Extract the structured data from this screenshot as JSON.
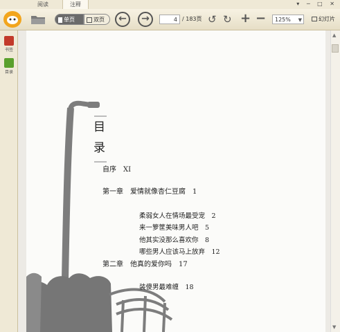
{
  "tabs": [
    {
      "label": "阅读"
    },
    {
      "label": "注释"
    }
  ],
  "window_buttons": "▾ ─ □ ✕",
  "toolbar": {
    "single_page": "单页",
    "double_page": "双页",
    "current_page": "4",
    "total_pages": "/ 183页",
    "zoom": "125%",
    "slideshow": "幻灯片"
  },
  "sidebar": {
    "items": [
      {
        "label": "书签",
        "icon": "bookmark-icon",
        "color": "#c23a2a"
      },
      {
        "label": "目录",
        "icon": "toc-icon",
        "color": "#5aa02c"
      }
    ]
  },
  "book": {
    "heading_1": "目",
    "heading_2": "录",
    "toc": [
      {
        "text": "自序　XI"
      },
      {
        "text": "第一章　爱情就像杏仁豆腐　1"
      },
      {
        "text": "柔弱女人在情场最受宠　2"
      },
      {
        "text": "来一箩筐美味男人吧　5"
      },
      {
        "text": "他其实没那么喜欢你　8"
      },
      {
        "text": "哪些男人应该马上放弃　12"
      },
      {
        "text": "第二章　他真的爱你吗　17"
      },
      {
        "text": "装傻男最难缠　18"
      }
    ]
  }
}
